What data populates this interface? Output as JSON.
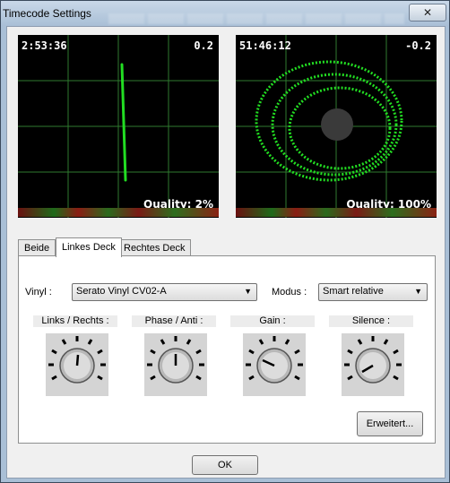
{
  "window": {
    "title": "Timecode Settings",
    "close_glyph": "✕"
  },
  "scopes": {
    "left": {
      "time": "2:53:36",
      "pitch": "0.2",
      "quality": "Quality: 2%"
    },
    "right": {
      "time": "51:46:12",
      "pitch": "-0.2",
      "quality": "Quality: 100%"
    }
  },
  "tabs": [
    "Beide",
    "Linkes Deck",
    "Rechtes Deck"
  ],
  "active_tab": "Linkes Deck",
  "deck": {
    "vinyl_label": "Vinyl :",
    "vinyl_value": "Serato Vinyl CV02-A",
    "mode_label": "Modus :",
    "mode_value": "Smart relative",
    "knobs": [
      {
        "label": "Links / Rechts :"
      },
      {
        "label": "Phase / Anti :"
      },
      {
        "label": "Gain :"
      },
      {
        "label": "Silence :"
      }
    ],
    "advanced_button": "Erweitert..."
  },
  "ok_button": "OK",
  "colors": {
    "scope_trace": "#22dd22",
    "scope_grid": "#2f7a2f",
    "titlebar": "#a9bfd6"
  }
}
